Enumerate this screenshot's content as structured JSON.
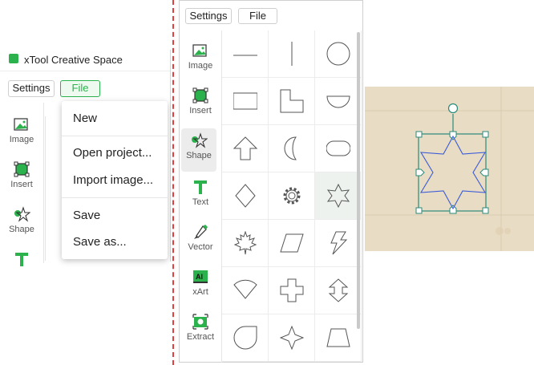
{
  "left_panel": {
    "app_title": "xTool Creative Space",
    "settings_label": "Settings",
    "file_label": "File",
    "sidebar": [
      "Image",
      "Insert",
      "Shape"
    ],
    "menu": {
      "items": [
        "New",
        "Open project...",
        "Import image...",
        "Save",
        "Save as..."
      ]
    }
  },
  "center_panel": {
    "settings_label": "Settings",
    "file_label": "File",
    "sidebar": [
      "Image",
      "Insert",
      "Shape",
      "Text",
      "Vector",
      "xArt",
      "Extract"
    ],
    "selected_sidebar": "Shape",
    "shapes": [
      "line",
      "vertical-line",
      "circle",
      "rectangle",
      "l-shape",
      "half-circle",
      "arrow-up",
      "crescent",
      "rounded-rectangle",
      "diamond",
      "gear",
      "star-6",
      "maple-leaf",
      "parallelogram",
      "lightning",
      "fan-sector",
      "cross",
      "double-arrow",
      "teardrop",
      "four-point-star",
      "trapezoid"
    ]
  },
  "canvas": {
    "shape": "six-point-star",
    "colors": {
      "stroke": "#3a5bd9",
      "selection": "#2a8a7a",
      "background": "#e8dcc4"
    }
  },
  "colors": {
    "accent": "#2bb24c",
    "divider": "#e04040"
  }
}
